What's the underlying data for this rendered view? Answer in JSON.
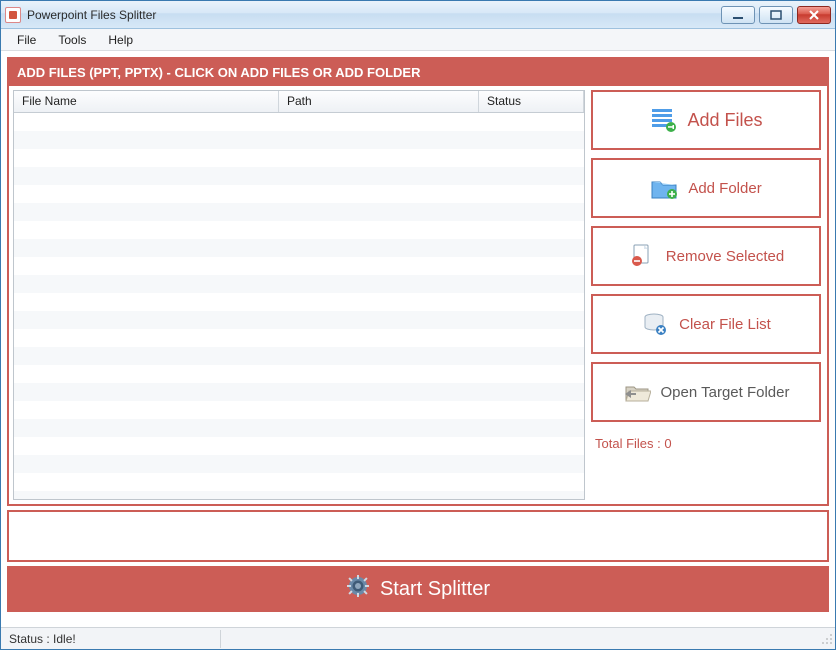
{
  "window": {
    "title": "Powerpoint Files Splitter"
  },
  "menubar": {
    "file": "File",
    "tools": "Tools",
    "help": "Help"
  },
  "banner": "ADD FILES (PPT, PPTX) - CLICK ON ADD FILES OR ADD FOLDER",
  "grid": {
    "columns": {
      "filename": "File Name",
      "path": "Path",
      "status": "Status"
    },
    "rows": []
  },
  "sidebar": {
    "add_files": "Add Files",
    "add_folder": "Add Folder",
    "remove_selected": "Remove Selected",
    "clear_list": "Clear File List",
    "open_target": "Open Target Folder",
    "total_files_label": "Total Files : 0"
  },
  "start_button": "Start Splitter",
  "statusbar": {
    "status_text": "Status  :  Idle!"
  }
}
